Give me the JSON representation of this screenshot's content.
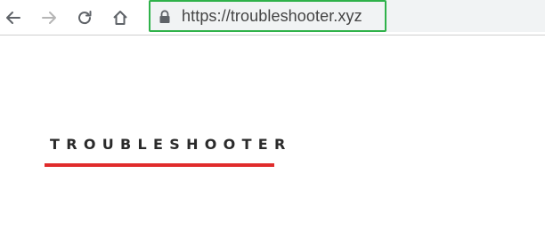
{
  "browser": {
    "url": "https://troubleshooter.xyz",
    "nav_icons": [
      "back-arrow-icon",
      "forward-arrow-icon",
      "reload-icon",
      "home-icon",
      "lock-icon"
    ],
    "highlight_color": "#2fb24a"
  },
  "page": {
    "brand": "TROUBLESHOOTER",
    "accent_color": "#e02b2b"
  }
}
